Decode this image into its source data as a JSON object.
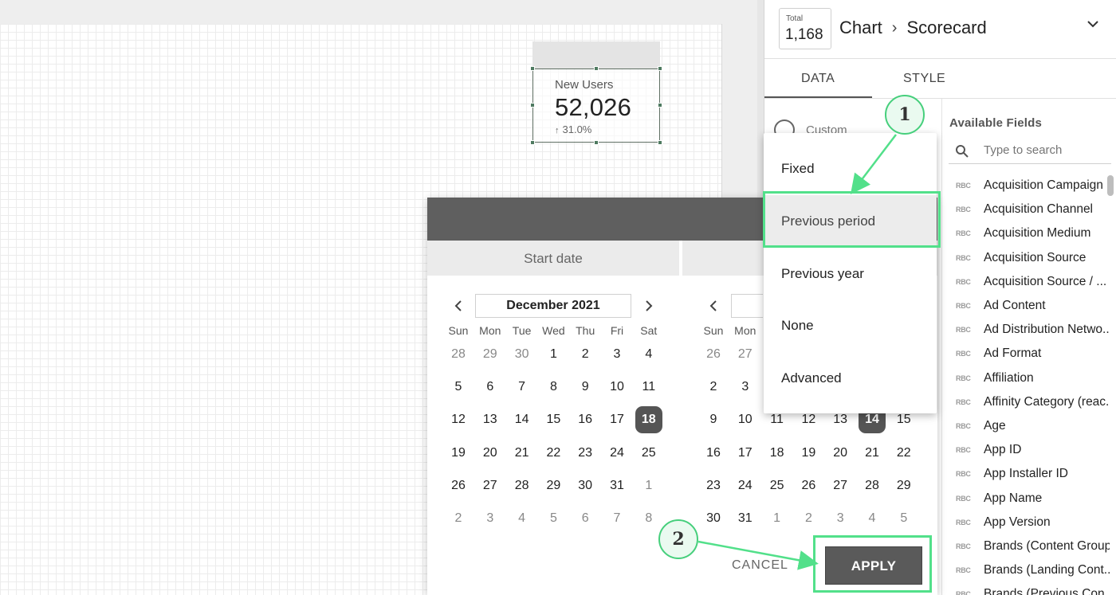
{
  "scorecard": {
    "title": "New Users",
    "value": "52,026",
    "delta": "31.0%"
  },
  "header": {
    "total_label": "Total",
    "total_value": "1,168",
    "crumb_chart": "Chart",
    "crumb_type": "Scorecard"
  },
  "tabs": {
    "data": "DATA",
    "style": "STYLE"
  },
  "left": {
    "radio_label": "Custom"
  },
  "fields": {
    "title": "Available Fields",
    "search_placeholder": "Type to search",
    "type_badge": "RBC",
    "items": [
      "Acquisition Campaign",
      "Acquisition Channel",
      "Acquisition Medium",
      "Acquisition Source",
      "Acquisition Source / ...",
      "Ad Content",
      "Ad Distribution Netwo...",
      "Ad Format",
      "Affiliation",
      "Affinity Category (reac...",
      "Age",
      "App ID",
      "App Installer ID",
      "App Name",
      "App Version",
      "Brands (Content Group)",
      "Brands (Landing Cont...",
      "Brands (Previous Con..."
    ]
  },
  "dialog": {
    "start_label": "Start date",
    "month_label": "December 2021",
    "weekdays": [
      "Sun",
      "Mon",
      "Tue",
      "Wed",
      "Thu",
      "Fri",
      "Sat"
    ],
    "left_weeks": [
      [
        "28",
        "29",
        "30",
        "1",
        "2",
        "3",
        "4"
      ],
      [
        "5",
        "6",
        "7",
        "8",
        "9",
        "10",
        "11"
      ],
      [
        "12",
        "13",
        "14",
        "15",
        "16",
        "17",
        "18"
      ],
      [
        "19",
        "20",
        "21",
        "22",
        "23",
        "24",
        "25"
      ],
      [
        "26",
        "27",
        "28",
        "29",
        "30",
        "31",
        "1"
      ],
      [
        "2",
        "3",
        "4",
        "5",
        "6",
        "7",
        "8"
      ]
    ],
    "right_weeks": [
      [
        "26",
        "27",
        "",
        "",
        "",
        "",
        ""
      ],
      [
        "2",
        "3",
        "",
        "",
        "",
        "",
        ""
      ],
      [
        "9",
        "10",
        "11",
        "12",
        "13",
        "14",
        "15"
      ],
      [
        "16",
        "17",
        "18",
        "19",
        "20",
        "21",
        "22"
      ],
      [
        "23",
        "24",
        "25",
        "26",
        "27",
        "28",
        "29"
      ],
      [
        "30",
        "31",
        "1",
        "2",
        "3",
        "4",
        "5"
      ]
    ],
    "cancel": "CANCEL",
    "apply": "APPLY"
  },
  "dropdown": {
    "items": [
      "Fixed",
      "Previous period",
      "Previous year",
      "None",
      "Advanced"
    ],
    "selected": "Previous period"
  },
  "annotations": {
    "step1": "1",
    "step2": "2",
    "color": "#52e08a"
  }
}
